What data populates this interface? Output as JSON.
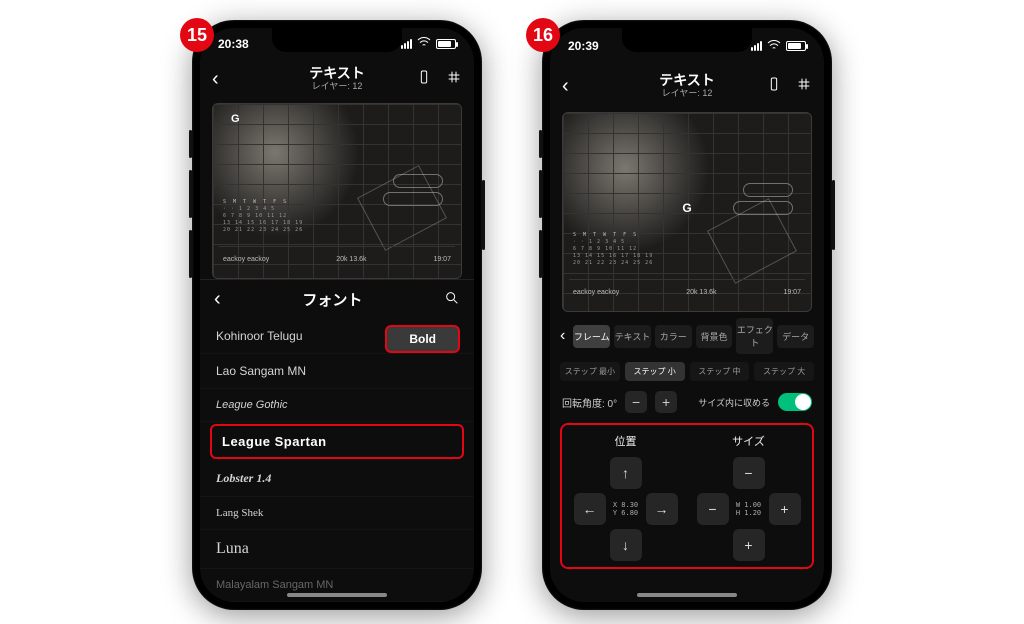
{
  "badges": {
    "b15": "15",
    "b16": "16"
  },
  "statusbar": {
    "time_left": "20:38",
    "time_right": "20:39"
  },
  "navbar": {
    "title": "テキスト",
    "subtitle": "レイヤー: 12"
  },
  "canvas": {
    "week_header": "S M T W T F S",
    "bottom_left": "eackoy\neackoy",
    "bottom_mid": "20k\n13.6k",
    "bottom_right": "19:07",
    "g_mark": "G"
  },
  "font_panel": {
    "title": "フォント",
    "weight_chip": "Bold",
    "items": [
      "Kohinoor Telugu",
      "Lao Sangam MN",
      "League Gothic",
      "League Spartan",
      "Lobster 1.4",
      "Lang Shek",
      "Luna",
      "Malayalam Sangam MN"
    ]
  },
  "frame_panel": {
    "tabs": [
      "フレーム",
      "テキスト",
      "カラー",
      "背景色",
      "エフェクト",
      "データ"
    ],
    "active_tab": 0,
    "steps": [
      "ステップ 最小",
      "ステップ 小",
      "ステップ 中",
      "ステップ 大"
    ],
    "active_step": 1,
    "angle_label": "回転角度: 0°",
    "fit_label": "サイズ内に収める",
    "col_position": "位置",
    "col_size": "サイズ",
    "pos_x": "X 8.30",
    "pos_y": "Y 6.80",
    "size_w": "W 1.00",
    "size_h": "H 1.20"
  }
}
